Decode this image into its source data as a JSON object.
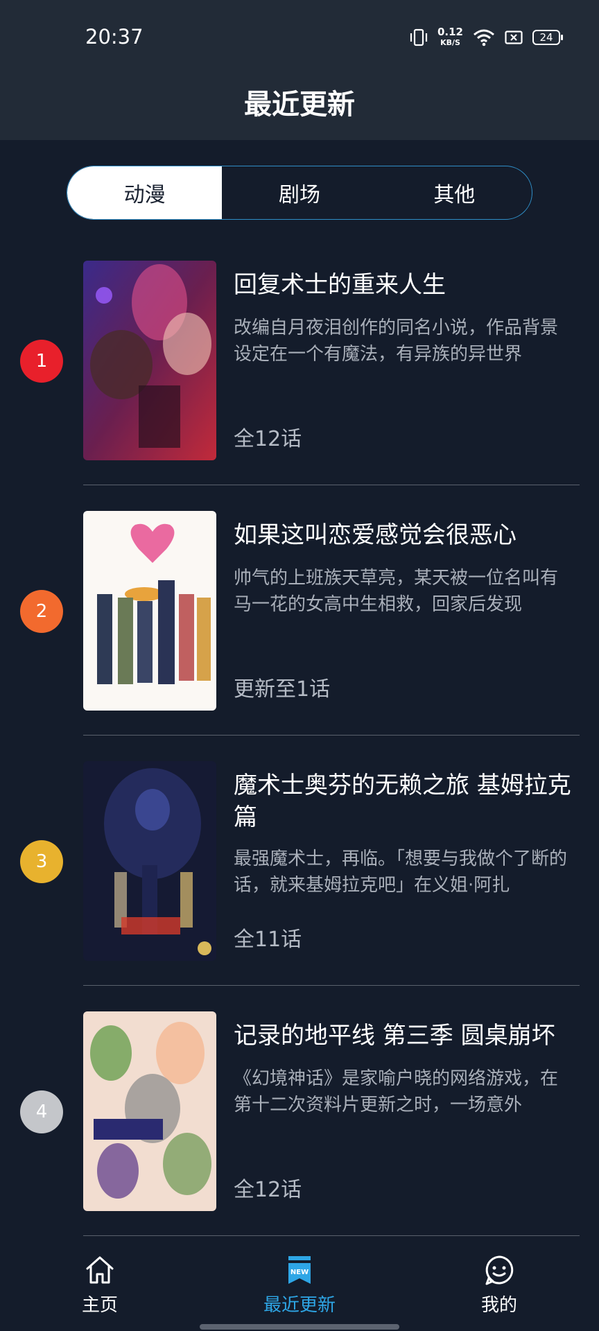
{
  "status_bar": {
    "time": "20:37",
    "net_speed": "0.12",
    "net_unit": "KB/S",
    "battery": "24"
  },
  "header": {
    "title": "最近更新"
  },
  "tabs": [
    {
      "label": "动漫",
      "active": true
    },
    {
      "label": "剧场",
      "active": false
    },
    {
      "label": "其他",
      "active": false
    }
  ],
  "anime_list": [
    {
      "rank": "1",
      "rank_color": "#e8202b",
      "title": "回复术士的重来人生",
      "description": "改编自月夜泪创作的同名小说，作品背景设定在一个有魔法，有异族的异世界",
      "episodes": "全12话"
    },
    {
      "rank": "2",
      "rank_color": "#f26a2e",
      "title": "如果这叫恋爱感觉会很恶心",
      "description": "帅气的上班族天草亮，某天被一位名叫有马一花的女高中生相救，回家后发现",
      "episodes": "更新至1话"
    },
    {
      "rank": "3",
      "rank_color": "#e8b22e",
      "title": "魔术士奥芬的无赖之旅 基姆拉克篇",
      "description": "最强魔术士，再临。「想要与我做个了断的话，就来基姆拉克吧」在义姐·阿扎",
      "episodes": "全11话"
    },
    {
      "rank": "4",
      "rank_color": "#c4c6ca",
      "title": "记录的地平线 第三季 圆桌崩坏",
      "description": "《幻境神话》是家喻户晓的网络游戏，在第十二次资料片更新之时，一场意外",
      "episodes": "全12话"
    }
  ],
  "tabbar": {
    "items": [
      {
        "label": "主页",
        "icon": "home-icon",
        "active": false
      },
      {
        "label": "最近更新",
        "icon": "new-badge-icon",
        "active": true
      },
      {
        "label": "我的",
        "icon": "smile-face-icon",
        "active": false
      }
    ],
    "new_badge_text": "NEW"
  },
  "colors": {
    "background": "#141c2b",
    "header": "#222b37",
    "accent": "#2ea6e6"
  }
}
